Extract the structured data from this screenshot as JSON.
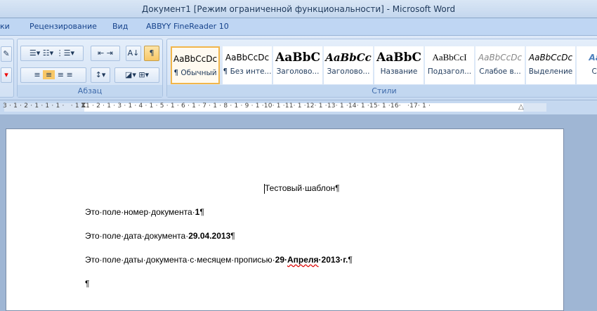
{
  "window": {
    "title": "Документ1 [Режим ограниченной функциональности] - Microsoft Word"
  },
  "tabs": [
    "ки",
    "Рецензирование",
    "Вид",
    "ABBYY FineReader 10"
  ],
  "ribbon": {
    "paragraph_group": "Абзац",
    "styles_group": "Стили",
    "pilcrow": "¶",
    "styles": [
      {
        "sample": "AaBbCcDc",
        "name": "¶ Обычный"
      },
      {
        "sample": "AaBbCcDc",
        "name": "¶ Без инте..."
      },
      {
        "sample": "AaBbC",
        "name": "Заголово..."
      },
      {
        "sample": "AaBbCc",
        "name": "Заголово..."
      },
      {
        "sample": "AaBbC",
        "name": "Название"
      },
      {
        "sample": "AaBbCcI",
        "name": "Подзагол..."
      },
      {
        "sample": "AaBbCcDc",
        "name": "Слабое в..."
      },
      {
        "sample": "AaBbCcDc",
        "name": "Выделение"
      },
      {
        "sample": "AaBb",
        "name": "Силь"
      }
    ]
  },
  "ruler": {
    "text": "3 · 1 · 2 · 1 · 1 · 1 ·   · 1 · 1 · 2 · 1 · 3 · 1 · 4 · 1 · 5 · 1 · 6 · 1 · 7 · 1 · 8 · 1 · 9 · 1 ·10· 1 ·11· 1 ·12· 1 ·13· 1 ·14· 1 ·15· 1 ·16·   ·17· 1 ·"
  },
  "document": {
    "title": "Тестовый·шаблон¶",
    "line1_text": "Это·поле·номер·документа·",
    "line1_value": "1",
    "line1_end": "¶",
    "line2_text": "Это·поле·дата·документа·",
    "line2_value": "29.04.2013",
    "line2_end": "¶",
    "line3_text": "Это·поле·даты·документа·с·месяцем·прописью·",
    "line3_v1": "29·",
    "line3_v2": "Апреля",
    "line3_v3": "·2013·г.",
    "line3_end": "¶",
    "empty": "¶"
  }
}
